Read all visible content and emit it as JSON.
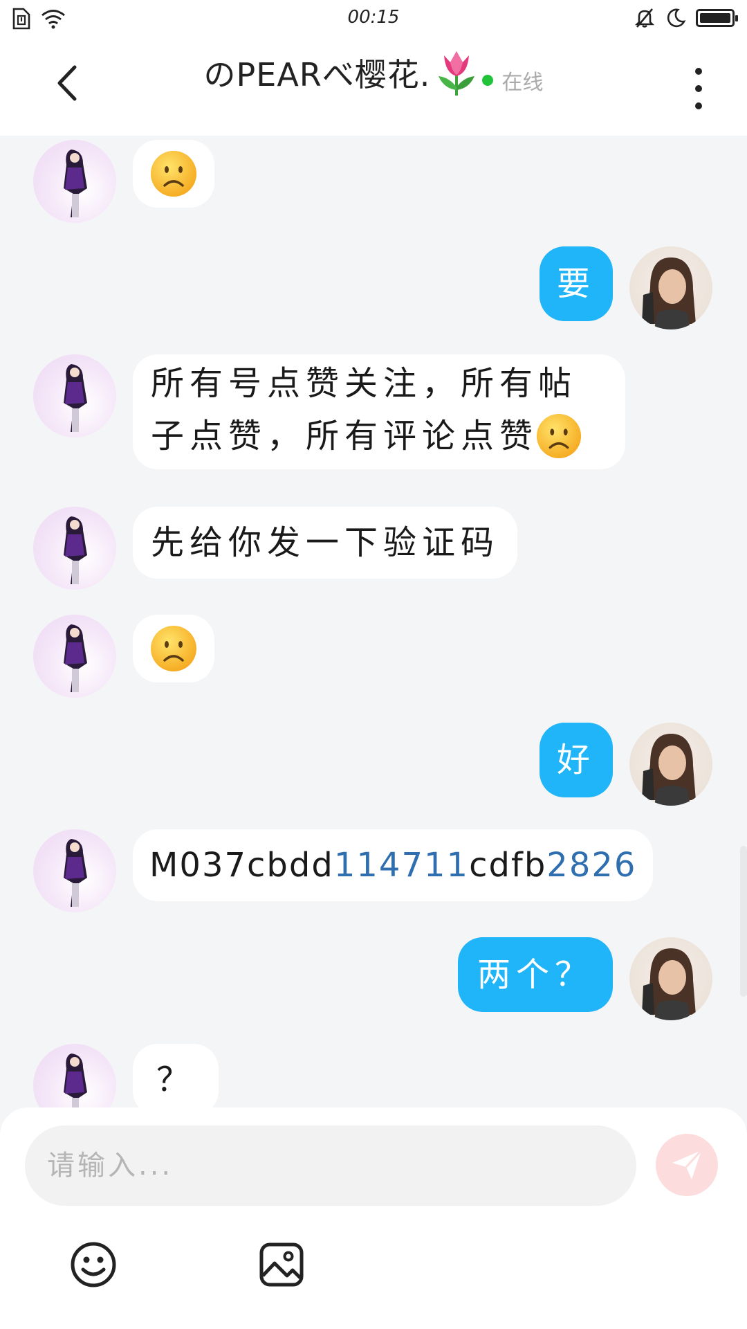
{
  "status_bar": {
    "time": "00:15"
  },
  "header": {
    "title": "のPEARべ樱花.",
    "status": "在线"
  },
  "messages": [
    {
      "side": "left",
      "type": "emoji",
      "emoji": "frowning-face"
    },
    {
      "side": "right",
      "type": "text",
      "text": "要"
    },
    {
      "side": "left",
      "type": "text",
      "line1": "所有号点赞关注，所有帖",
      "line2": "子点赞，所有评论点赞",
      "trailing_emoji": "frowning-face"
    },
    {
      "side": "left",
      "type": "text",
      "text": "先给你发一下验证码"
    },
    {
      "side": "left",
      "type": "emoji",
      "emoji": "frowning-face"
    },
    {
      "side": "right",
      "type": "text",
      "text": "好"
    },
    {
      "side": "left",
      "type": "code",
      "parts": [
        "M037cbdd",
        "114711",
        "cdfb",
        "2826"
      ]
    },
    {
      "side": "right",
      "type": "text",
      "text": "两个？"
    },
    {
      "side": "left",
      "type": "text",
      "text": "？"
    }
  ],
  "composer": {
    "placeholder": "请输入..."
  },
  "colors": {
    "accent_blue": "#1fb5f8",
    "online_green": "#22c33a",
    "send_disabled": "#fcdcdc",
    "link_blue": "#2f6fb0"
  }
}
